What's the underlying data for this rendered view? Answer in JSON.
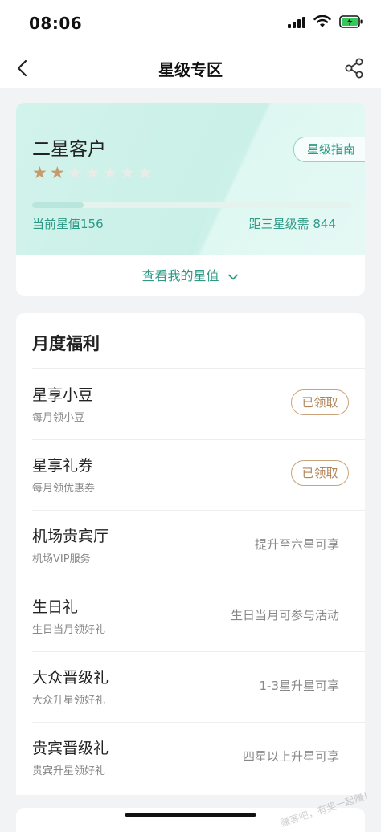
{
  "status_bar": {
    "time": "08:06"
  },
  "nav": {
    "title": "星级专区"
  },
  "star_card": {
    "tier_name": "二星客户",
    "guide_label": "星级指南",
    "stars_filled": 2,
    "stars_total": 7,
    "progress_percent": 16,
    "current_stars_text": "当前星值156",
    "next_level_text": "距三星级需 844",
    "view_stars_label": "查看我的星值"
  },
  "benefits": {
    "section_title": "月度福利",
    "items": [
      {
        "name": "星享小豆",
        "desc": "每月领小豆",
        "status": "已领取",
        "claimed": true
      },
      {
        "name": "星享礼券",
        "desc": "每月领优惠券",
        "status": "已领取",
        "claimed": true
      },
      {
        "name": "机场贵宾厅",
        "desc": "机场VIP服务",
        "status": "提升至六星可享",
        "claimed": false
      },
      {
        "name": "生日礼",
        "desc": "生日当月领好礼",
        "status": "生日当月可参与活动",
        "claimed": false
      },
      {
        "name": "大众晋级礼",
        "desc": "大众升星领好礼",
        "status": "1-3星升星可享",
        "claimed": false
      },
      {
        "name": "贵宾晋级礼",
        "desc": "贵宾升星领好礼",
        "status": "四星以上升星可享",
        "claimed": false
      }
    ]
  },
  "watermark": "赚客吧，有奖一起赚！",
  "colors": {
    "accent": "#2e9a86",
    "star_filled": "#c89a6a",
    "badge": "#b08458"
  }
}
